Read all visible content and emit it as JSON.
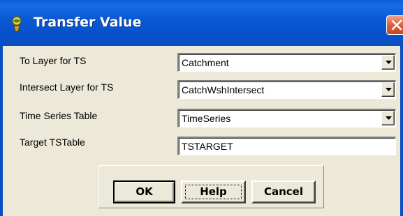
{
  "window": {
    "title": "Transfer Value",
    "icon": "globe-person-icon",
    "close_icon": "close-icon"
  },
  "fields": [
    {
      "label": "To Layer for TS",
      "value": "Catchment",
      "kind": "combo"
    },
    {
      "label": "Intersect Layer for TS",
      "value": "CatchWshIntersect",
      "kind": "combo"
    },
    {
      "label": "Time Series Table",
      "value": "TimeSeries",
      "kind": "combo"
    },
    {
      "label": "Target TSTable",
      "value": "TSTARGET",
      "kind": "text"
    }
  ],
  "buttons": {
    "ok": "OK",
    "help": "Help",
    "cancel": "Cancel"
  },
  "colors": {
    "titlebar": "#0a58d4",
    "dialog_face": "#ece9d8",
    "close_button": "#e2623f"
  }
}
